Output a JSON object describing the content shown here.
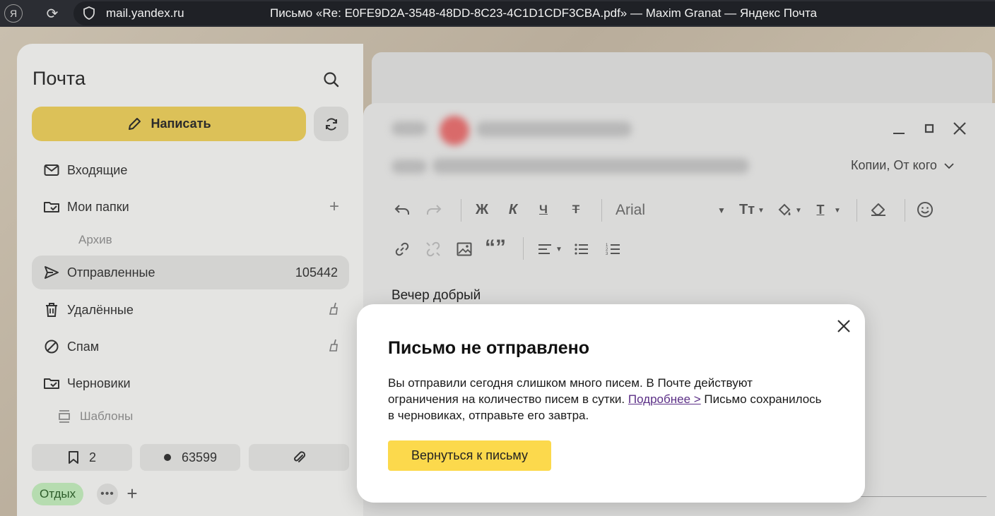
{
  "browser": {
    "ya_glyph": "Я",
    "url": "mail.yandex.ru",
    "page_title": "Письмо «Re: E0FE9D2A-3548-48DD-8C23-4C1D1CDF3CBA.pdf» — Maxim Granat — Яндекс Почта"
  },
  "sidebar": {
    "brand": "Почта",
    "compose_label": "Написать",
    "folders": [
      {
        "label": "Входящие",
        "icon": "inbox-icon"
      },
      {
        "label": "Мои папки",
        "icon": "folder-icon",
        "trail": "+"
      },
      {
        "label": "Архив",
        "icon": "none"
      },
      {
        "label": "Отправленные",
        "icon": "sent-icon",
        "count": "105442",
        "active": true
      },
      {
        "label": "Удалённые",
        "icon": "trash-icon",
        "trail": "broom-icon"
      },
      {
        "label": "Спам",
        "icon": "spam-icon",
        "trail": "broom-icon"
      },
      {
        "label": "Черновики",
        "icon": "folder-icon"
      },
      {
        "label": "Шаблоны",
        "icon": "templates-icon"
      }
    ],
    "bottom": {
      "bookmarks_count": "2",
      "unread_count": "63599"
    },
    "tags": {
      "tag1": "Отдых",
      "more": "•••",
      "add": "+"
    }
  },
  "compose": {
    "copies_label": "Копии, От кого",
    "font_name": "Arial",
    "toolbar": {
      "bold": "Ж",
      "italic": "К",
      "underline": "Ч",
      "strike": "Т",
      "text_size": "Тт",
      "text_color": "Т"
    },
    "body_line1": "Вечер добрый"
  },
  "modal": {
    "title": "Письмо не отправлено",
    "text_part1": "Вы отправили сегодня слишком много писем. В Почте действуют ограничения на количество писем в сутки. ",
    "link_label": "Подробнее >",
    "text_part2": " Письмо сохранилось в черновиках, отправьте его завтра.",
    "button_label": "Вернуться к письму"
  },
  "colors": {
    "compose_button": "#dcc158",
    "modal_button": "#fcd94c",
    "tag_green": "#b6dcb0",
    "link": "#5b2f86"
  }
}
